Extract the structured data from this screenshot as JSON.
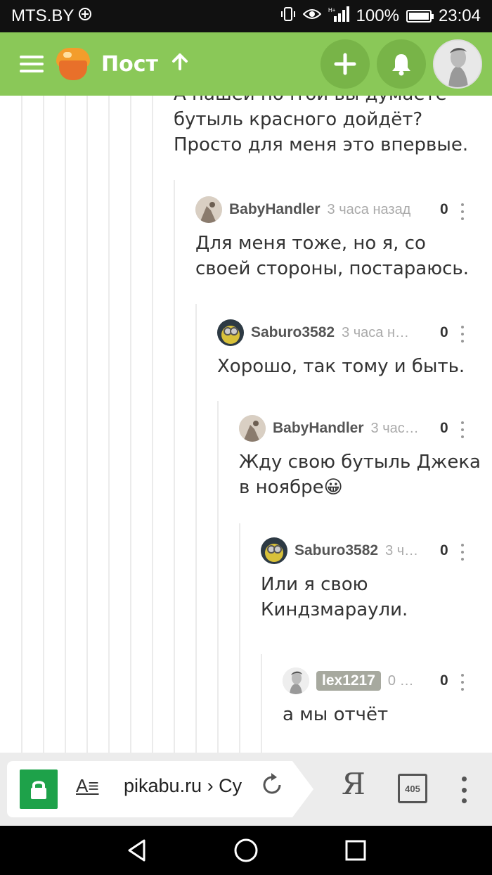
{
  "status_bar": {
    "carrier": "MTS.BY",
    "battery": "100%",
    "battery_level": 1.0,
    "time": "23:04"
  },
  "header": {
    "title": "Пост",
    "menu_icon": "hamburger-menu-icon",
    "up_icon": "arrow-up-icon",
    "add_icon": "plus-icon",
    "notify_icon": "bell-icon",
    "accent_color": "#8ac858"
  },
  "comments": {
    "top_partial_text": "А нашей почтой вы думаете бутыль красного дойдёт? Просто для меня это впервые.",
    "top_partial_lines": [
      "А нашей почтой вы думаете",
      "бутыль красного дойдёт?",
      "Просто для меня это впервые."
    ],
    "items": [
      {
        "author": "BabyHandler",
        "time": "3 часа назад",
        "score": "0",
        "lines": [
          "Для меня тоже, но я, со",
          "своей стороны, постараюсь."
        ]
      },
      {
        "author": "Saburo3582",
        "time": "3 часа н…",
        "score": "0",
        "lines": [
          "Хорошо, так тому и быть."
        ]
      },
      {
        "author": "BabyHandler",
        "time": "3 час…",
        "score": "0",
        "lines": [
          "Жду свою бутыль Джека",
          "в ноябре😀"
        ]
      },
      {
        "author": "Saburo3582",
        "time": "3 ч…",
        "score": "0",
        "lines": [
          "Или я свою",
          "Киндзмараули."
        ]
      },
      {
        "author": "lex1217",
        "time": "0 …",
        "score": "0",
        "lines": [
          "а мы отчёт"
        ]
      }
    ]
  },
  "browser": {
    "url": "pikabu.ru › Су",
    "tab_count": "405",
    "yandex_label": "Я",
    "reader_label": "A≡",
    "lock_icon": "lock-icon",
    "reload_icon": "reload-icon"
  },
  "nav": {
    "back_icon": "back-triangle-icon",
    "home_icon": "home-circle-icon",
    "recents_icon": "recents-square-icon"
  }
}
